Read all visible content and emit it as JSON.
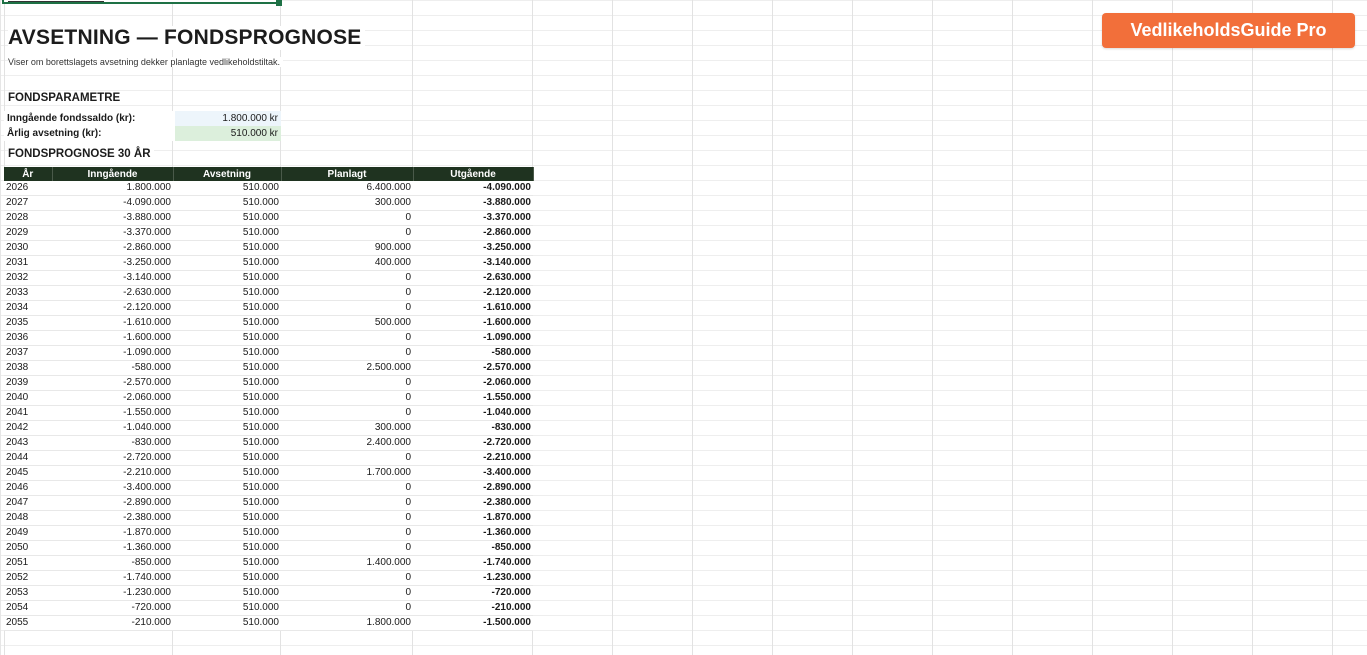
{
  "brand": {
    "label": "VedlikeholdsGuide Pro",
    "color": "#f26f3a"
  },
  "sheet": {
    "title": "AVSETNING — FONDSPROGNOSE",
    "subtitle": "Viser om borettslagets avsetning dekker planlagte vedlikeholdstiltak."
  },
  "params": {
    "heading": "FONDSPARAMETRE",
    "opening_label": "Inngående fondssaldo (kr):",
    "opening_value": "1.800.000 kr",
    "annual_label": "Årlig avsetning (kr):",
    "annual_value": "510.000 kr"
  },
  "forecast": {
    "heading": "FONDSPROGNOSE 30 ÅR",
    "header_color": "#1f3320",
    "columns": [
      "År",
      "Inngående",
      "Avsetning",
      "Planlagt",
      "Utgående"
    ],
    "rows": [
      [
        "2026",
        "1.800.000",
        "510.000",
        "6.400.000",
        "-4.090.000"
      ],
      [
        "2027",
        "-4.090.000",
        "510.000",
        "300.000",
        "-3.880.000"
      ],
      [
        "2028",
        "-3.880.000",
        "510.000",
        "0",
        "-3.370.000"
      ],
      [
        "2029",
        "-3.370.000",
        "510.000",
        "0",
        "-2.860.000"
      ],
      [
        "2030",
        "-2.860.000",
        "510.000",
        "900.000",
        "-3.250.000"
      ],
      [
        "2031",
        "-3.250.000",
        "510.000",
        "400.000",
        "-3.140.000"
      ],
      [
        "2032",
        "-3.140.000",
        "510.000",
        "0",
        "-2.630.000"
      ],
      [
        "2033",
        "-2.630.000",
        "510.000",
        "0",
        "-2.120.000"
      ],
      [
        "2034",
        "-2.120.000",
        "510.000",
        "0",
        "-1.610.000"
      ],
      [
        "2035",
        "-1.610.000",
        "510.000",
        "500.000",
        "-1.600.000"
      ],
      [
        "2036",
        "-1.600.000",
        "510.000",
        "0",
        "-1.090.000"
      ],
      [
        "2037",
        "-1.090.000",
        "510.000",
        "0",
        "-580.000"
      ],
      [
        "2038",
        "-580.000",
        "510.000",
        "2.500.000",
        "-2.570.000"
      ],
      [
        "2039",
        "-2.570.000",
        "510.000",
        "0",
        "-2.060.000"
      ],
      [
        "2040",
        "-2.060.000",
        "510.000",
        "0",
        "-1.550.000"
      ],
      [
        "2041",
        "-1.550.000",
        "510.000",
        "0",
        "-1.040.000"
      ],
      [
        "2042",
        "-1.040.000",
        "510.000",
        "300.000",
        "-830.000"
      ],
      [
        "2043",
        "-830.000",
        "510.000",
        "2.400.000",
        "-2.720.000"
      ],
      [
        "2044",
        "-2.720.000",
        "510.000",
        "0",
        "-2.210.000"
      ],
      [
        "2045",
        "-2.210.000",
        "510.000",
        "1.700.000",
        "-3.400.000"
      ],
      [
        "2046",
        "-3.400.000",
        "510.000",
        "0",
        "-2.890.000"
      ],
      [
        "2047",
        "-2.890.000",
        "510.000",
        "0",
        "-2.380.000"
      ],
      [
        "2048",
        "-2.380.000",
        "510.000",
        "0",
        "-1.870.000"
      ],
      [
        "2049",
        "-1.870.000",
        "510.000",
        "0",
        "-1.360.000"
      ],
      [
        "2050",
        "-1.360.000",
        "510.000",
        "0",
        "-850.000"
      ],
      [
        "2051",
        "-850.000",
        "510.000",
        "1.400.000",
        "-1.740.000"
      ],
      [
        "2052",
        "-1.740.000",
        "510.000",
        "0",
        "-1.230.000"
      ],
      [
        "2053",
        "-1.230.000",
        "510.000",
        "0",
        "-720.000"
      ],
      [
        "2054",
        "-720.000",
        "510.000",
        "0",
        "-210.000"
      ],
      [
        "2055",
        "-210.000",
        "510.000",
        "1.800.000",
        "-1.500.000"
      ]
    ]
  }
}
